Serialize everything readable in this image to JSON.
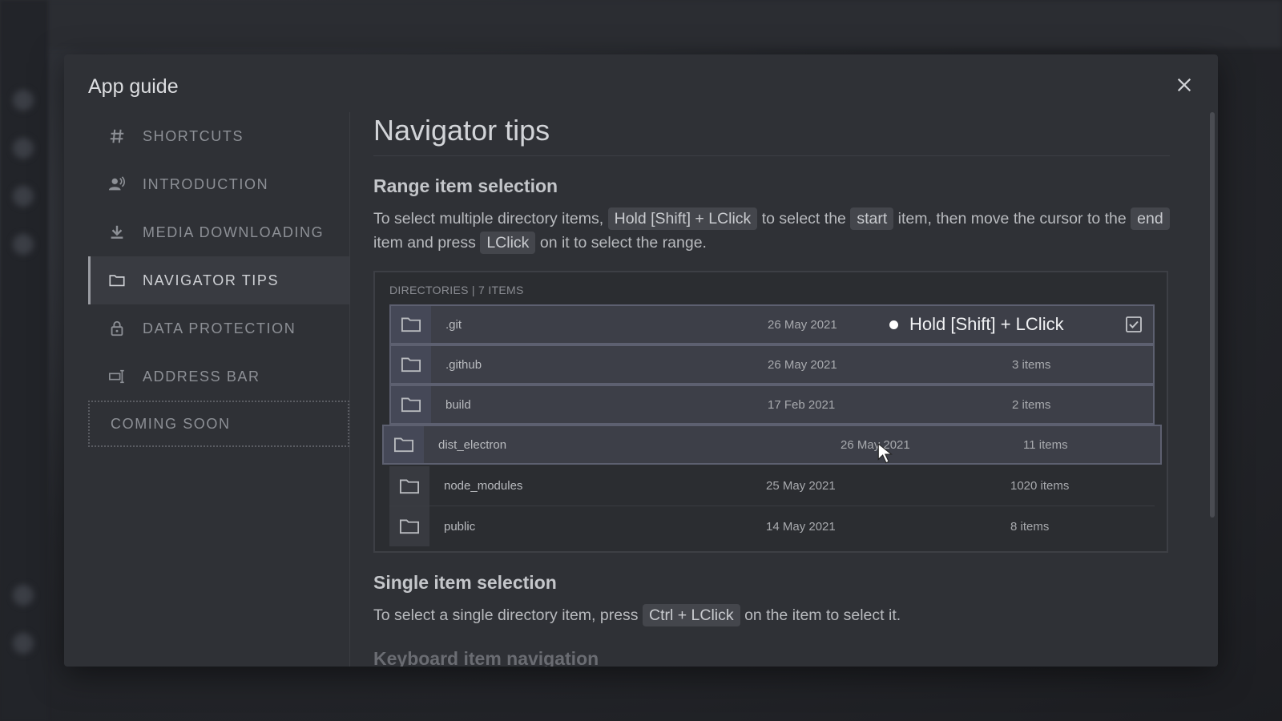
{
  "dialog": {
    "title": "App guide"
  },
  "sidebar": {
    "items": [
      {
        "label": "SHORTCUTS",
        "icon": "hash-icon"
      },
      {
        "label": "INTRODUCTION",
        "icon": "person-voice-icon"
      },
      {
        "label": "MEDIA DOWNLOADING",
        "icon": "download-icon"
      },
      {
        "label": "NAVIGATOR TIPS",
        "icon": "folder-icon",
        "active": true
      },
      {
        "label": "DATA PROTECTION",
        "icon": "lock-icon"
      },
      {
        "label": "ADDRESS BAR",
        "icon": "address-bar-icon"
      }
    ],
    "coming_soon": "COMING SOON"
  },
  "content": {
    "title": "Navigator tips",
    "range": {
      "heading": "Range item selection",
      "p1": "To select multiple directory items,",
      "k1": "Hold [Shift] + LClick",
      "p2": "to select the",
      "k2": "start",
      "p3": "item, then move the cursor to the",
      "k3": "end",
      "p4": "item and press",
      "k4": "LClick",
      "p5": "on it to select the range."
    },
    "demo": {
      "header": "DIRECTORIES | 7 ITEMS",
      "tooltip": "Hold [Shift] + LClick",
      "rows": [
        {
          "name": ".git",
          "date": "26 May 2021",
          "count": "",
          "selected": true
        },
        {
          "name": ".github",
          "date": "26 May 2021",
          "count": "3 items",
          "selected": true
        },
        {
          "name": "build",
          "date": "17 Feb 2021",
          "count": "2 items",
          "selected": true
        },
        {
          "name": "dist_electron",
          "date": "26 May 2021",
          "count": "11 items",
          "selected": true
        },
        {
          "name": "node_modules",
          "date": "25 May 2021",
          "count": "1020 items",
          "selected": false
        },
        {
          "name": "public",
          "date": "14 May 2021",
          "count": "8 items",
          "selected": false
        }
      ]
    },
    "single": {
      "heading": "Single item selection",
      "p1": "To select a single directory item, press",
      "k1": "Ctrl + LClick",
      "p2": "on the item to select it."
    },
    "keyboard": {
      "heading": "Keyboard item navigation"
    }
  },
  "colors": {
    "dialog_bg": "#2f3136",
    "accent_selected": "#5d6070"
  }
}
